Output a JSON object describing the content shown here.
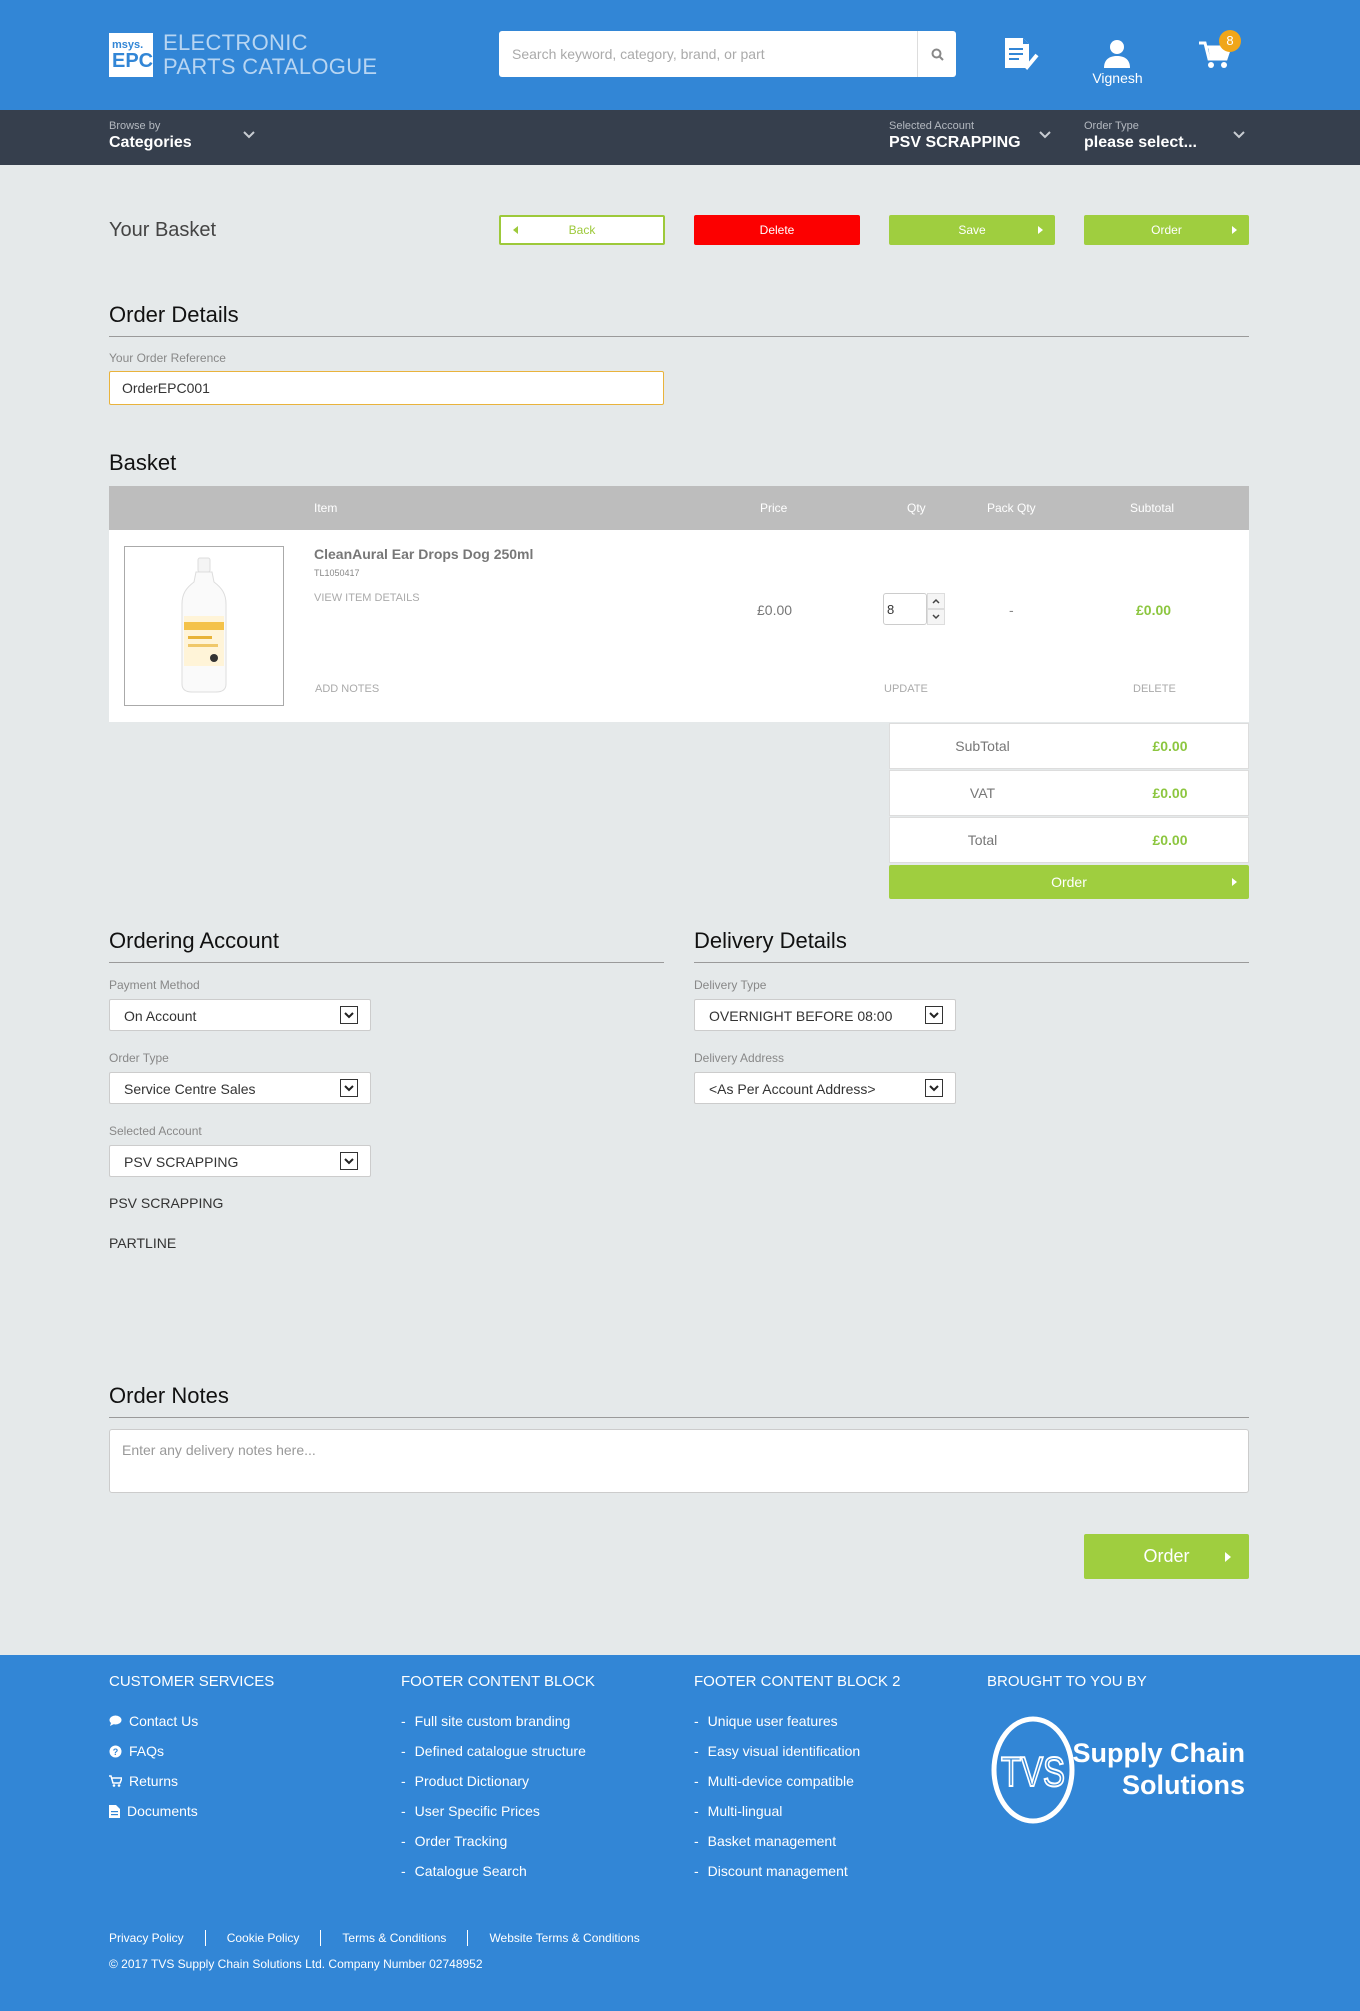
{
  "header": {
    "logo_small": "msys.",
    "logo_big": "EPC",
    "logo_line1": "ELECTRONIC",
    "logo_line2": "PARTS CATALOGUE",
    "search_placeholder": "Search keyword, category, brand, or part",
    "user_name": "Vignesh",
    "cart_count": "8"
  },
  "subnav": {
    "browse_label": "Browse by",
    "browse_value": "Categories",
    "account_label": "Selected Account",
    "account_value": "PSV SCRAPPING",
    "order_type_label": "Order Type",
    "order_type_value": "please select..."
  },
  "basket_header": {
    "title": "Your Basket",
    "back": "Back",
    "delete": "Delete",
    "save": "Save",
    "order": "Order"
  },
  "order_details": {
    "title": "Order Details",
    "ref_label": "Your Order Reference",
    "ref_value": "OrderEPC001"
  },
  "basket": {
    "title": "Basket",
    "columns": {
      "item": "Item",
      "price": "Price",
      "qty": "Qty",
      "pack_qty": "Pack Qty",
      "subtotal": "Subtotal"
    },
    "item": {
      "name": "CleanAural Ear Drops Dog 250ml",
      "sku": "TL1050417",
      "view_details": "VIEW ITEM DETAILS",
      "add_notes": "ADD NOTES",
      "price": "£0.00",
      "qty": "8",
      "pack_qty": "-",
      "subtotal": "£0.00",
      "update": "UPDATE",
      "delete": "DELETE"
    }
  },
  "totals": {
    "subtotal_label": "SubTotal",
    "subtotal_value": "£0.00",
    "vat_label": "VAT",
    "vat_value": "£0.00",
    "total_label": "Total",
    "total_value": "£0.00",
    "order_button": "Order"
  },
  "ordering_account": {
    "title": "Ordering Account",
    "payment_label": "Payment Method",
    "payment_value": "On Account",
    "order_type_label": "Order Type",
    "order_type_value": "Service Centre Sales",
    "account_label": "Selected Account",
    "account_value": "PSV SCRAPPING",
    "info_line1": "PSV SCRAPPING",
    "info_line2": "PARTLINE"
  },
  "delivery": {
    "title": "Delivery Details",
    "type_label": "Delivery Type",
    "type_value": "OVERNIGHT BEFORE 08:00",
    "address_label": "Delivery Address",
    "address_value": "<As Per Account Address>"
  },
  "notes": {
    "title": "Order Notes",
    "placeholder": "Enter any delivery notes here...",
    "order_button": "Order"
  },
  "footer": {
    "col1": {
      "title": "CUSTOMER SERVICES",
      "items": [
        "Contact Us",
        "FAQs",
        "Returns",
        "Documents"
      ]
    },
    "col2": {
      "title": "FOOTER CONTENT BLOCK",
      "items": [
        "Full site custom branding",
        "Defined catalogue structure",
        "Product Dictionary",
        "User Specific Prices",
        "Order Tracking",
        "Catalogue Search"
      ]
    },
    "col3": {
      "title": "FOOTER CONTENT BLOCK 2",
      "items": [
        "Unique user features",
        "Easy visual identification",
        "Multi-device compatible",
        "Multi-lingual",
        "Basket management",
        "Discount management"
      ]
    },
    "col4": {
      "title": "BROUGHT TO YOU BY",
      "brand_mark": "TVS",
      "brand_line1": "Supply Chain",
      "brand_line2": "Solutions"
    },
    "links": [
      "Privacy Policy",
      "Cookie Policy",
      "Terms & Conditions",
      "Website Terms & Conditions"
    ],
    "copyright": "© 2017 TVS Supply Chain Solutions Ltd. Company Number 02748952"
  },
  "colors": {
    "brand_blue": "#3286d6",
    "dark_nav": "#363f4d",
    "green": "#9fce3f",
    "red": "#fc0000",
    "badge": "#f0a619"
  }
}
